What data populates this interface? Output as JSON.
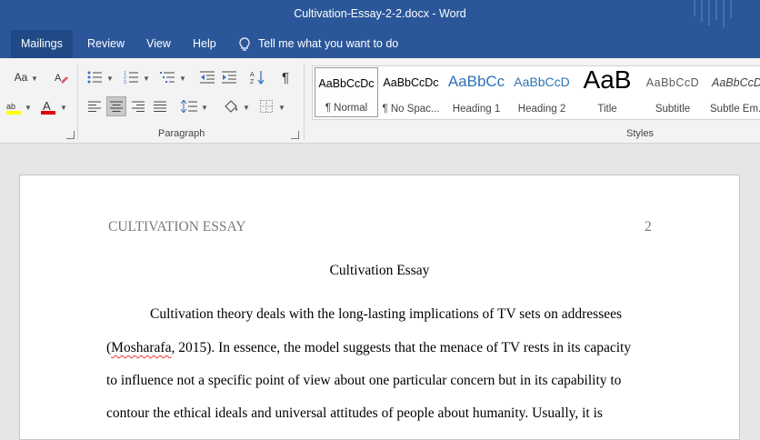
{
  "window": {
    "title": "Cultivation-Essay-2-2.docx  -  Word"
  },
  "tabs": [
    {
      "label": "Mailings",
      "active": true
    },
    {
      "label": "Review",
      "active": false
    },
    {
      "label": "View",
      "active": false
    },
    {
      "label": "Help",
      "active": false
    }
  ],
  "tellme": {
    "text": "Tell me what you want to do",
    "icon": "lightbulb-icon"
  },
  "ribbon": {
    "font_case_label": "Aa",
    "paragraph_group_label": "Paragraph",
    "styles_group_label": "Styles",
    "highlight_color": "#ffff00",
    "font_color": "#e00000",
    "styles": [
      {
        "preview": "AaBbCcDc",
        "name": "¶ Normal",
        "selected": true
      },
      {
        "preview": "AaBbCcDc",
        "name": "¶ No Spac...",
        "selected": false
      },
      {
        "preview": "AaBbCc",
        "name": "Heading 1",
        "selected": false
      },
      {
        "preview": "AaBbCcD",
        "name": "Heading 2",
        "selected": false
      },
      {
        "preview": "AaB",
        "name": "Title",
        "selected": false
      },
      {
        "preview": "AaBbCcD",
        "name": "Subtitle",
        "selected": false
      },
      {
        "preview": "AaBbCcD",
        "name": "Subtle Em...",
        "selected": false
      }
    ]
  },
  "document": {
    "header_left": "CULTIVATION ESSAY",
    "header_right": "2",
    "title": "Cultivation Essay",
    "lines": {
      "l1": "Cultivation theory deals with the long-lasting implications of TV sets on addressees",
      "l2_pre": "(",
      "l2_misspelled": "Mosharafa",
      "l2_post": ", 2015). In essence, the model suggests that the menace of TV rests in its capacity",
      "l3": "to influence not a specific point of view about one particular concern but in its capability to",
      "l4": "contour the ethical ideals and universal attitudes of people about humanity. Usually, it is"
    }
  }
}
